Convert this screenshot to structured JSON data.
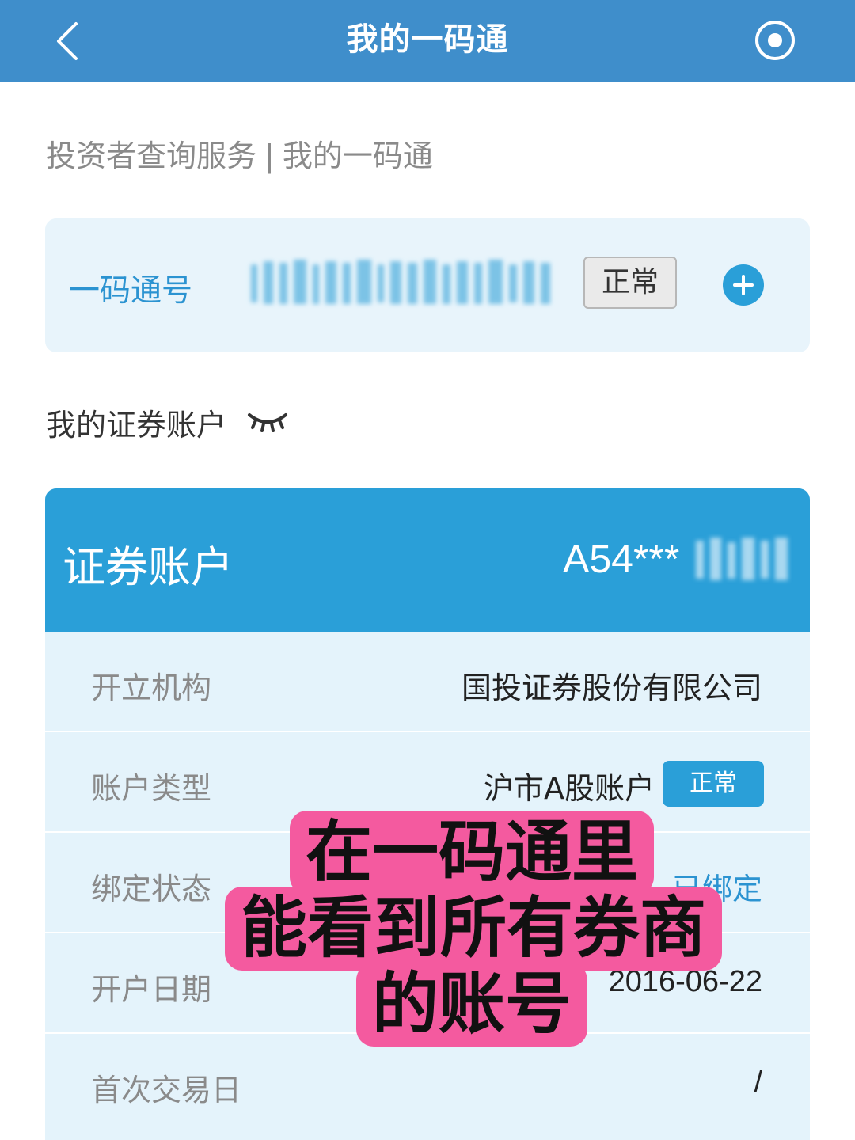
{
  "navbar": {
    "title": "我的一码通"
  },
  "breadcrumb": {
    "part1": "投资者查询服务",
    "separator": "|",
    "part2": "我的一码通"
  },
  "code_card": {
    "label": "一码通号",
    "status": "正常"
  },
  "section": {
    "title": "我的证券账户"
  },
  "account": {
    "title": "证券账户",
    "number": "A54***",
    "rows": [
      {
        "label": "开立机构",
        "value": "国投证券股份有限公司"
      },
      {
        "label": "账户类型",
        "value": "沪市A股账户",
        "badge": "正常"
      },
      {
        "label": "绑定状态",
        "value": "已绑定"
      },
      {
        "label": "开户日期",
        "value": "2016-06-22"
      },
      {
        "label": "首次交易日",
        "value": "/"
      }
    ]
  },
  "overlay": {
    "line1": "在一码通里",
    "line2": "能看到所有券商",
    "line3": "的账号"
  },
  "colors": {
    "navbar": "#3f8ecb",
    "accent": "#2a9fd8",
    "card_bg": "#e4f3fb",
    "overlay": "#f45a9f"
  },
  "icons": [
    "chevron-left-icon",
    "target-icon",
    "plus-circle-icon",
    "eye-closed-icon"
  ]
}
